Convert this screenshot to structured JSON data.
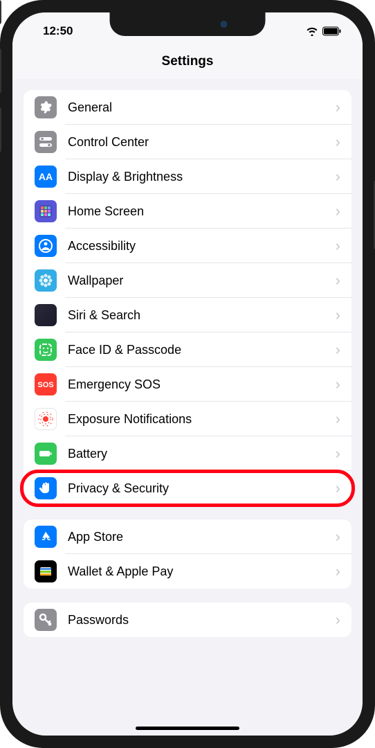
{
  "statusBar": {
    "time": "12:50"
  },
  "header": {
    "title": "Settings"
  },
  "groups": [
    {
      "rows": [
        {
          "id": "general",
          "icon": "gear",
          "label": "General",
          "bg": "bg-gray"
        },
        {
          "id": "control-center",
          "icon": "switches",
          "label": "Control Center",
          "bg": "bg-gray"
        },
        {
          "id": "display",
          "icon": "aa",
          "label": "Display & Brightness",
          "bg": "bg-blue"
        },
        {
          "id": "home",
          "icon": "grid",
          "label": "Home Screen",
          "bg": "bg-indigo"
        },
        {
          "id": "accessibility",
          "icon": "person",
          "label": "Accessibility",
          "bg": "bg-blue"
        },
        {
          "id": "wallpaper",
          "icon": "flower",
          "label": "Wallpaper",
          "bg": "bg-teal"
        },
        {
          "id": "siri",
          "icon": "siri",
          "label": "Siri & Search",
          "bg": "bg-siri"
        },
        {
          "id": "faceid",
          "icon": "face",
          "label": "Face ID & Passcode",
          "bg": "bg-green"
        },
        {
          "id": "sos",
          "icon": "sos",
          "label": "Emergency SOS",
          "bg": "bg-red"
        },
        {
          "id": "exposure",
          "icon": "exposure",
          "label": "Exposure Notifications",
          "bg": "bg-white"
        },
        {
          "id": "battery",
          "icon": "battery",
          "label": "Battery",
          "bg": "bg-green"
        },
        {
          "id": "privacy",
          "icon": "hand",
          "label": "Privacy & Security",
          "bg": "bg-blue",
          "highlighted": true
        }
      ]
    },
    {
      "rows": [
        {
          "id": "appstore",
          "icon": "appstore",
          "label": "App Store",
          "bg": "bg-blue"
        },
        {
          "id": "wallet",
          "icon": "wallet",
          "label": "Wallet & Apple Pay",
          "bg": "bg-black"
        }
      ]
    },
    {
      "rows": [
        {
          "id": "passwords",
          "icon": "key",
          "label": "Passwords",
          "bg": "bg-lightgray"
        }
      ]
    }
  ]
}
